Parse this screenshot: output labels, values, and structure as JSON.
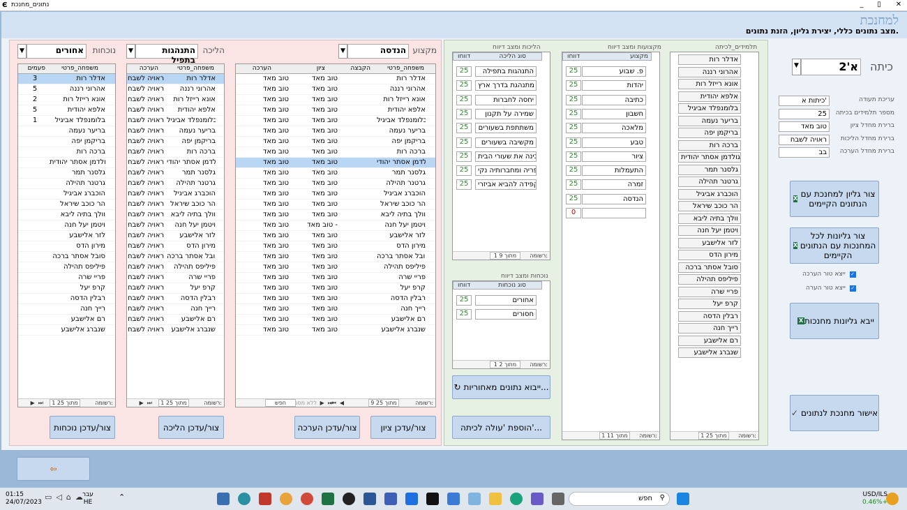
{
  "window": {
    "title": "נתונים_מחנכת",
    "min": "_",
    "max": "▯",
    "close": "✕"
  },
  "header": {
    "title": "למחנכת",
    "subtitle": "מצב נתונים כללי, יצירת גליון, הזנת נתונים."
  },
  "left": {
    "subject_label": "מקצוע",
    "subject_value": "הנדסה",
    "walk_label": "הליכה",
    "walk_value": "התנהגות בתפיל",
    "attend_label": "נוכחות",
    "attend_value": "אחורים",
    "grade_grid": {
      "headers": [
        "משפחה_פרטי",
        "הקבצה",
        "ציון",
        "הערכה"
      ],
      "rows": [
        [
          "אדלר רות",
          "",
          "טוב מאד",
          "טוב מאד"
        ],
        [
          "אהרוני רננה",
          "",
          "טוב מאד",
          "טוב מאד"
        ],
        [
          "אונא רייזל רות",
          "",
          "טוב מאד",
          "טוב מאד"
        ],
        [
          "אלפא יהודית",
          "",
          "טוב מאד",
          "טוב מאד"
        ],
        [
          "בלומנפלד אביגיל",
          "",
          "טוב מאד",
          "טוב מאד"
        ],
        [
          "בריער נעמה",
          "",
          "טוב מאד",
          "טוב מאד"
        ],
        [
          "בריקמן יפה",
          "",
          "טוב מאד",
          "טוב מאד"
        ],
        [
          "ברכה רות",
          "",
          "טוב מאד",
          "טוב מאד"
        ],
        [
          "גולדמן אסתר יהודי",
          "",
          "טוב מאד",
          "טוב מאד"
        ],
        [
          "גלסנר תמר",
          "",
          "טוב מאד",
          "טוב מאד"
        ],
        [
          "גרטנר תהילה",
          "",
          "טוב מאד",
          "טוב מאד"
        ],
        [
          "הוכברג אביגיל",
          "",
          "טוב מאד",
          "טוב מאד"
        ],
        [
          "הר כוכב שיראל",
          "",
          "טוב מאד",
          "טוב מאד"
        ],
        [
          "וולך בתיה ליבא",
          "",
          "טוב מאד",
          "טוב מאד"
        ],
        [
          "ויטמן יעל חנה",
          "",
          "טוב מאד -",
          "טוב מאד"
        ],
        [
          "לזר אלישבע",
          "",
          "טוב מאד",
          "טוב מאד"
        ],
        [
          "מירון הדס",
          "",
          "טוב מאד",
          "טוב מאד"
        ],
        [
          "סובל אסתר ברכה",
          "",
          "טוב מאד",
          "טוב מאד"
        ],
        [
          "פיליפס תהילה",
          "",
          "טוב מאד",
          "טוב מאד"
        ],
        [
          "פריי שרה",
          "",
          "טוב מאד",
          "טוב מאד"
        ],
        [
          "קרפ יעל",
          "",
          "טוב מאד",
          "טוב מאד"
        ],
        [
          "רבלין הדסה",
          "",
          "טוב מאד",
          "טוב מאד"
        ],
        [
          "רייך חנה",
          "",
          "טוב מאד",
          "טוב מאד"
        ],
        [
          "רם אלישבע",
          "",
          "טוב מאד",
          "טוב מאד"
        ],
        [
          "שנברג אלישבע",
          "",
          "טוב מאד",
          "טוב מאד"
        ]
      ],
      "nav": {
        "record": "רשומה:",
        "count": "9 מתוך 25",
        "filter": "ללא מסנן",
        "search": "חפש"
      }
    },
    "walk_grid": {
      "headers": [
        "משפחה_פרטי",
        "הערכה"
      ],
      "rows": [
        [
          "אדלר רות",
          "ראויה לשבח"
        ],
        [
          "אהרוני רננה",
          "ראויה לשבח"
        ],
        [
          "אונא רייזל רות",
          "ראויה לשבח"
        ],
        [
          "אלפא יהודית",
          "ראויה לשבח"
        ],
        [
          "בלומנפלד אביגיל",
          "ראויה לשבח"
        ],
        [
          "בריער נעמה",
          "ראויה לשבח"
        ],
        [
          "בריקמן יפה",
          "ראויה לשבח"
        ],
        [
          "ברכה רות",
          "ראויה לשבח"
        ],
        [
          "גולדמן אסתר יהודי",
          "ראויה לשבח"
        ],
        [
          "גלסנר תמר",
          "ראויה לשבח"
        ],
        [
          "גרטנר תהילה",
          "ראויה לשבח"
        ],
        [
          "הוכברג אביגיל",
          "ראויה לשבח"
        ],
        [
          "הר כוכב שיראל",
          "ראויה לשבח"
        ],
        [
          "וולך בתיה ליבא",
          "ראויה לשבח"
        ],
        [
          "ויטמן יעל חנה",
          "ראויה לשבח"
        ],
        [
          "לזר אלישבע",
          "ראויה לשבח"
        ],
        [
          "מירון הדס",
          "ראויה לשבח"
        ],
        [
          "סובל אסתר ברכה",
          "ראויה לשבח"
        ],
        [
          "פיליפס תהילה",
          "ראויה לשבח"
        ],
        [
          "פריי שרה",
          "ראויה לשבח"
        ],
        [
          "קרפ יעל",
          "ראויה לשבח"
        ],
        [
          "רבלין הדסה",
          "ראויה לשבח"
        ],
        [
          "רייך חנה",
          "ראויה לשבח"
        ],
        [
          "רם אלישבע",
          "ראויה לשבח"
        ],
        [
          "שנברג אלישבע",
          "ראויה לשבח"
        ]
      ],
      "nav": {
        "record": "רשומה:",
        "count": "1 מתוך 25"
      }
    },
    "attend_grid": {
      "headers": [
        "משפחה_פרטי",
        "פעמים"
      ],
      "rows": [
        [
          "אדלר רות",
          "3"
        ],
        [
          "אהרוני רננה",
          "5"
        ],
        [
          "אונא רייזל רות",
          "2"
        ],
        [
          "אלפא יהודית",
          "5"
        ],
        [
          "בלומנפלד אביגיל",
          "1"
        ],
        [
          "בריער נעמה",
          ""
        ],
        [
          "בריקמן יפה",
          ""
        ],
        [
          "ברכה רות",
          ""
        ],
        [
          "גולדמן אסתר יהודית",
          ""
        ],
        [
          "גלסנר תמר",
          ""
        ],
        [
          "גרטנר תהילה",
          ""
        ],
        [
          "הוכברג אביגיל",
          ""
        ],
        [
          "הר כוכב שיראל",
          ""
        ],
        [
          "וולך בתיה ליבא",
          ""
        ],
        [
          "ויטמן יעל חנה",
          ""
        ],
        [
          "לזר אלישבע",
          ""
        ],
        [
          "מירון הדס",
          ""
        ],
        [
          "סובל אסתר ברכה",
          ""
        ],
        [
          "פיליפס תהילה",
          ""
        ],
        [
          "פריי שרה",
          ""
        ],
        [
          "קרפ יעל",
          ""
        ],
        [
          "רבלין הדסה",
          ""
        ],
        [
          "רייך חנה",
          ""
        ],
        [
          "רם אלישבע",
          ""
        ],
        [
          "שנברג אלישבע",
          ""
        ]
      ],
      "nav": {
        "record": "רשומה:",
        "count": "1 מתוך 25"
      }
    },
    "btn_grade": "צור/עדכן ציון",
    "btn_eval": "צור/עדכן הערכה",
    "btn_walk": "צור/עדכן הליכה",
    "btn_attend": "צור/עדכן נוכחות"
  },
  "mid": {
    "students_label": "תלמידים_לכיתה",
    "students": [
      "אדלר רות",
      "אהרוני רננה",
      "אונא רייזל רות",
      "אלפא יהודית",
      "בלומנפלד אביגיל",
      "בריער נעמה",
      "בריקמן יפה",
      "ברכה רות",
      "גולדמן אסתר יהודית",
      "גלסנר תמר",
      "גרטנר תהילה",
      "הוכברג אביגיל",
      "הר כוכב שיראל",
      "וולך בתיה ליבא",
      "ויטמן יעל חנה",
      "לזר אלישבע",
      "מירון הדס",
      "סובל אסתר ברכה",
      "פיליפס תהילה",
      "פריי שרה",
      "קרפ יעל",
      "רבלין הדסה",
      "רייך חנה",
      "רם אלישבע",
      "שנברג אלישבע"
    ],
    "students_nav": {
      "record": "רשומה:",
      "count": "1 מתוך 25"
    },
    "subjects_label": "מקצועות ומצב דיווח",
    "subjects_col1": "מקצוע",
    "subjects_col2": "דווחו",
    "subjects": [
      [
        "פ. שבוע",
        "25"
      ],
      [
        "יהדות",
        "25"
      ],
      [
        "כתיבה",
        "25"
      ],
      [
        "חשבון",
        "25"
      ],
      [
        "מלאכה",
        "25"
      ],
      [
        "טבע",
        "25"
      ],
      [
        "ציור",
        "25"
      ],
      [
        "התעמלות",
        "25"
      ],
      [
        "זמרה",
        "25"
      ],
      [
        "הנדסה",
        "25"
      ],
      [
        "",
        "0"
      ]
    ],
    "subjects_nav": {
      "record": "רשומה:",
      "count": "1 מתוך 11"
    },
    "walks_label": "הליכות ומצב דיווח",
    "walks_col1": "סוג הליכה",
    "walks_col2": "דווחו",
    "walks": [
      [
        "התנהגות בתפילה",
        "25"
      ],
      [
        "מתנהגת בדרך ארץ",
        "25"
      ],
      [
        "יחסה לחברות",
        "25"
      ],
      [
        "שמירה על תקנון",
        "25"
      ],
      [
        "משתתפת בשעורים",
        "25"
      ],
      [
        "מקשיבה בשעורים",
        "25"
      ],
      [
        "מכינה את שעורי הבית",
        "25"
      ],
      [
        "ספריה ומחברותיה נקי",
        "25"
      ],
      [
        "מקפידה להביא אביזרי",
        "25"
      ]
    ],
    "walks_nav": {
      "record": "רשומה:",
      "count": "1 מתוך 9"
    },
    "attends_label": "נוכחות ומצב דיווח",
    "attends_col1": "סוג נוכחות",
    "attends_col2": "דווחו",
    "attends": [
      [
        "אחורים",
        "25"
      ],
      [
        "חסורים",
        "25"
      ]
    ],
    "attends_nav": {
      "record": "רשומה:",
      "count": "1 מתוך 2"
    },
    "btn_import": "ייבוא נתונים מאחוריות...",
    "btn_add": "הוספת 'עולה לכיתה'..."
  },
  "right": {
    "class_label": "כיתה",
    "class_value": "א'2",
    "fields": [
      [
        "עריכת תעודה",
        "כיתות א'"
      ],
      [
        "מספר תלמידים בכיתה",
        "25"
      ],
      [
        "ברירת מחדל ציון",
        "טוב מאד"
      ],
      [
        "ברירת מחדל הליכות",
        "ראויה לשבח"
      ],
      [
        "ברירת מחדל הערכה",
        "בב"
      ]
    ],
    "btn_sheet": "צור גליון למחנכת עם הנתונים הקיימים",
    "btn_all": "צור גליונות לכל המחנכות עם הנתונים הקיימים",
    "chk1": "ייצא טור הערכה",
    "chk2": "ייצא טור הערה",
    "btn_import": "ייבא גליונות מחנכות",
    "btn_confirm": "אישור מחנכת לנתונים"
  },
  "taskbar": {
    "time": "01:15",
    "date": "24/07/2023",
    "lang1": "עבר",
    "lang2": "HE",
    "search": "חפש",
    "ticker": "USD/ILS",
    "change": "0.46%+"
  }
}
